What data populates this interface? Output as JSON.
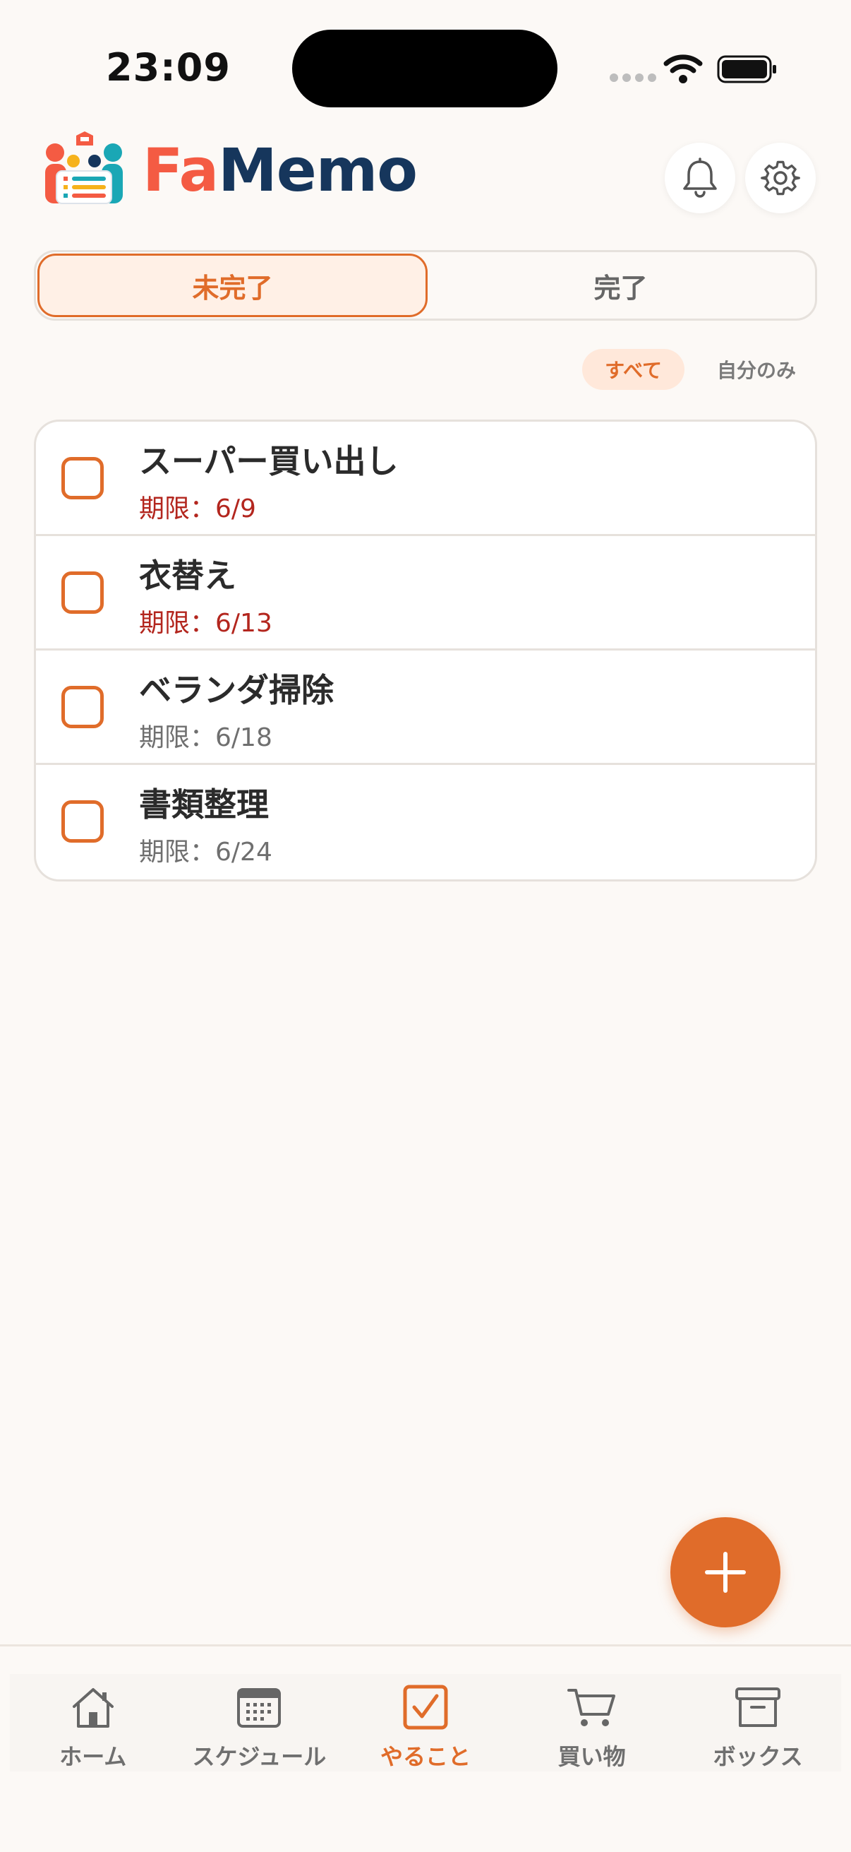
{
  "status_bar": {
    "time": "23:09"
  },
  "header": {
    "logo_part1": "Fa",
    "logo_part2": "Memo",
    "bell_icon": "bell-icon",
    "gear_icon": "gear-icon"
  },
  "segment": {
    "incomplete_label": "未完了",
    "complete_label": "完了",
    "selected": "incomplete"
  },
  "filter": {
    "all_label": "すべて",
    "mine_label": "自分のみ",
    "selected": "all"
  },
  "tasks": [
    {
      "title": "スーパー買い出し",
      "due": "期限：6/9",
      "overdue": true,
      "checked": false
    },
    {
      "title": "衣替え",
      "due": "期限：6/13",
      "overdue": true,
      "checked": false
    },
    {
      "title": "ベランダ掃除",
      "due": "期限：6/18",
      "overdue": false,
      "checked": false
    },
    {
      "title": "書類整理",
      "due": "期限：6/24",
      "overdue": false,
      "checked": false
    }
  ],
  "nav": {
    "home": "ホーム",
    "schedule": "スケジュール",
    "todo": "やること",
    "shopping": "買い物",
    "box": "ボックス",
    "active": "todo"
  },
  "colors": {
    "accent": "#E06C2A",
    "overdue": "#B3261E",
    "logo_fa": "#F45B43",
    "logo_memo": "#16365C",
    "background": "#FCF9F6"
  }
}
